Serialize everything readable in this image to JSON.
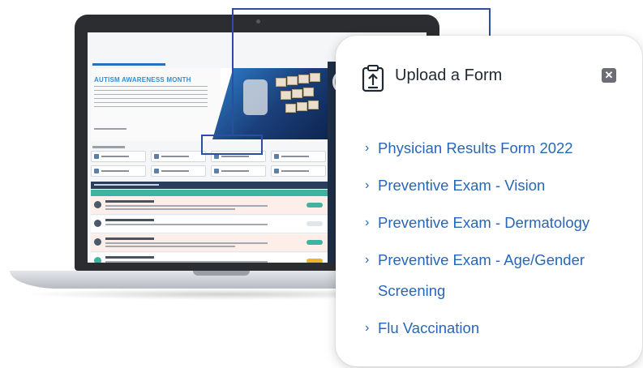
{
  "upload_card": {
    "title": "Upload a Form",
    "close_label": "✕",
    "items": [
      {
        "chevron": "›",
        "label": "Physician Results Form 2022"
      },
      {
        "chevron": "›",
        "label": "Preventive Exam - Vision"
      },
      {
        "chevron": "›",
        "label": "Preventive Exam - Dermatology"
      },
      {
        "chevron": "›",
        "label": "Preventive Exam - Age/Gender Screening"
      },
      {
        "chevron": "›",
        "label": "Flu Vaccination"
      }
    ]
  },
  "dashboard": {
    "hero_title": "AUTISM AWARENESS MONTH"
  },
  "colors": {
    "link": "#2866b8",
    "connector": "#2b4ea2",
    "laptop_frame": "#2b2d31",
    "hero_accent": "#2f8fd6"
  },
  "icons": [
    "clipboard-upload-icon",
    "close-icon",
    "chevron-right-icon"
  ]
}
